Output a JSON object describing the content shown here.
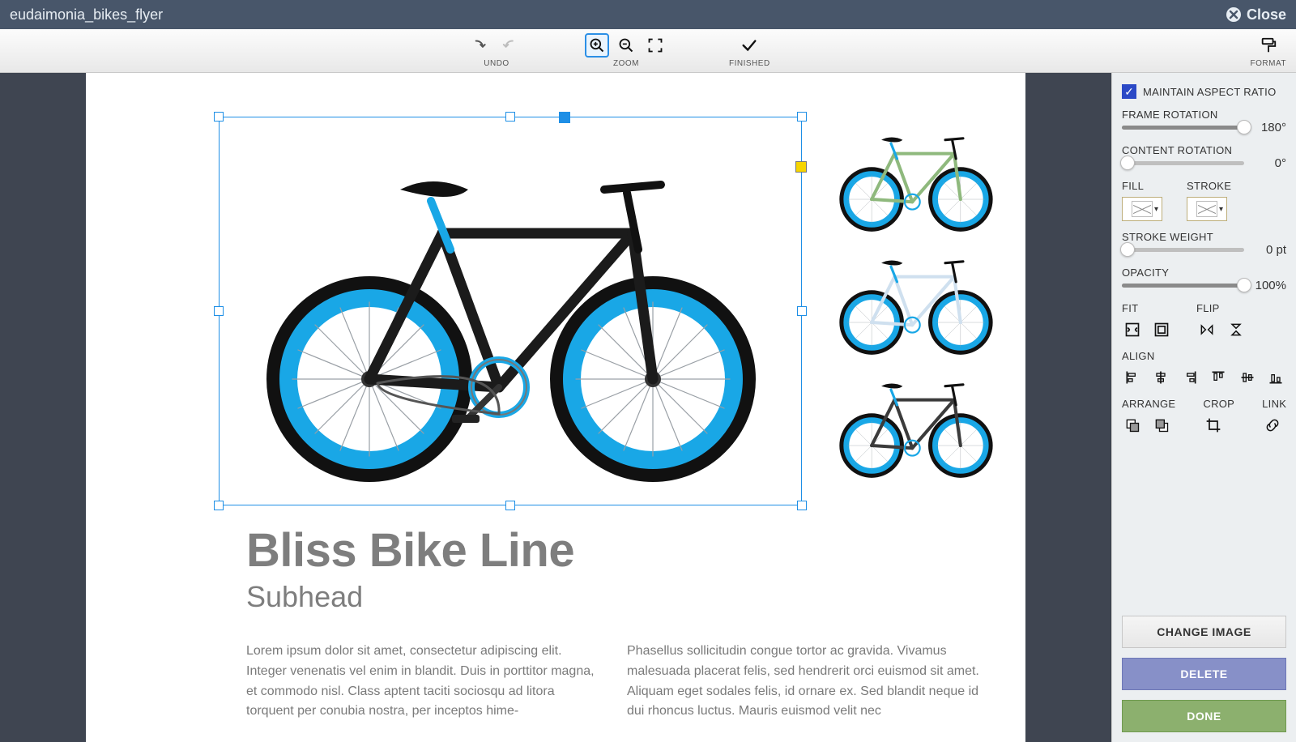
{
  "window": {
    "title": "eudaimonia_bikes_flyer",
    "close_label": "Close"
  },
  "toolbar": {
    "undo_label": "UNDO",
    "zoom_label": "ZOOM",
    "finished_label": "FINISHED",
    "format_label": "FORMAT"
  },
  "sidebar": {
    "maintain_aspect": "MAINTAIN ASPECT RATIO",
    "frame_rotation_label": "FRAME ROTATION",
    "frame_rotation_value": "180°",
    "frame_rotation_pct": 100,
    "content_rotation_label": "CONTENT ROTATION",
    "content_rotation_value": "0°",
    "content_rotation_pct": 0,
    "fill_label": "FILL",
    "stroke_label": "STROKE",
    "stroke_weight_label": "STROKE WEIGHT",
    "stroke_weight_value": "0 pt",
    "stroke_weight_pct": 0,
    "opacity_label": "OPACITY",
    "opacity_value": "100%",
    "opacity_pct": 100,
    "fit_label": "FIT",
    "flip_label": "FLIP",
    "align_label": "ALIGN",
    "arrange_label": "ARRANGE",
    "crop_label": "CROP",
    "link_label": "LINK",
    "change_image_label": "CHANGE IMAGE",
    "delete_label": "DELETE",
    "done_label": "DONE"
  },
  "document": {
    "headline": "Bliss Bike Line",
    "subhead": "Subhead",
    "col1": "Lorem ipsum dolor sit amet, consectetur adipiscing elit. Integer venenatis vel enim in blandit. Duis in porttitor magna, et commodo nisl. Class aptent taciti sociosqu ad litora torquent per conubia nostra, per inceptos hime-",
    "col2": "Phasellus sollicitudin congue tortor ac gravida. Vivamus malesuada placerat felis, sed hendrerit orci euismod sit amet. Aliquam eget sodales felis, id ornare ex. Sed blandit neque id dui rhoncus luctus. Mauris euismod velit nec",
    "thumbs": [
      {
        "frame_color": "#8fb97d"
      },
      {
        "frame_color": "#cfe0ef"
      },
      {
        "frame_color": "#3b3b3b"
      }
    ],
    "main_bike_frame_color": "#1b1b1b"
  }
}
